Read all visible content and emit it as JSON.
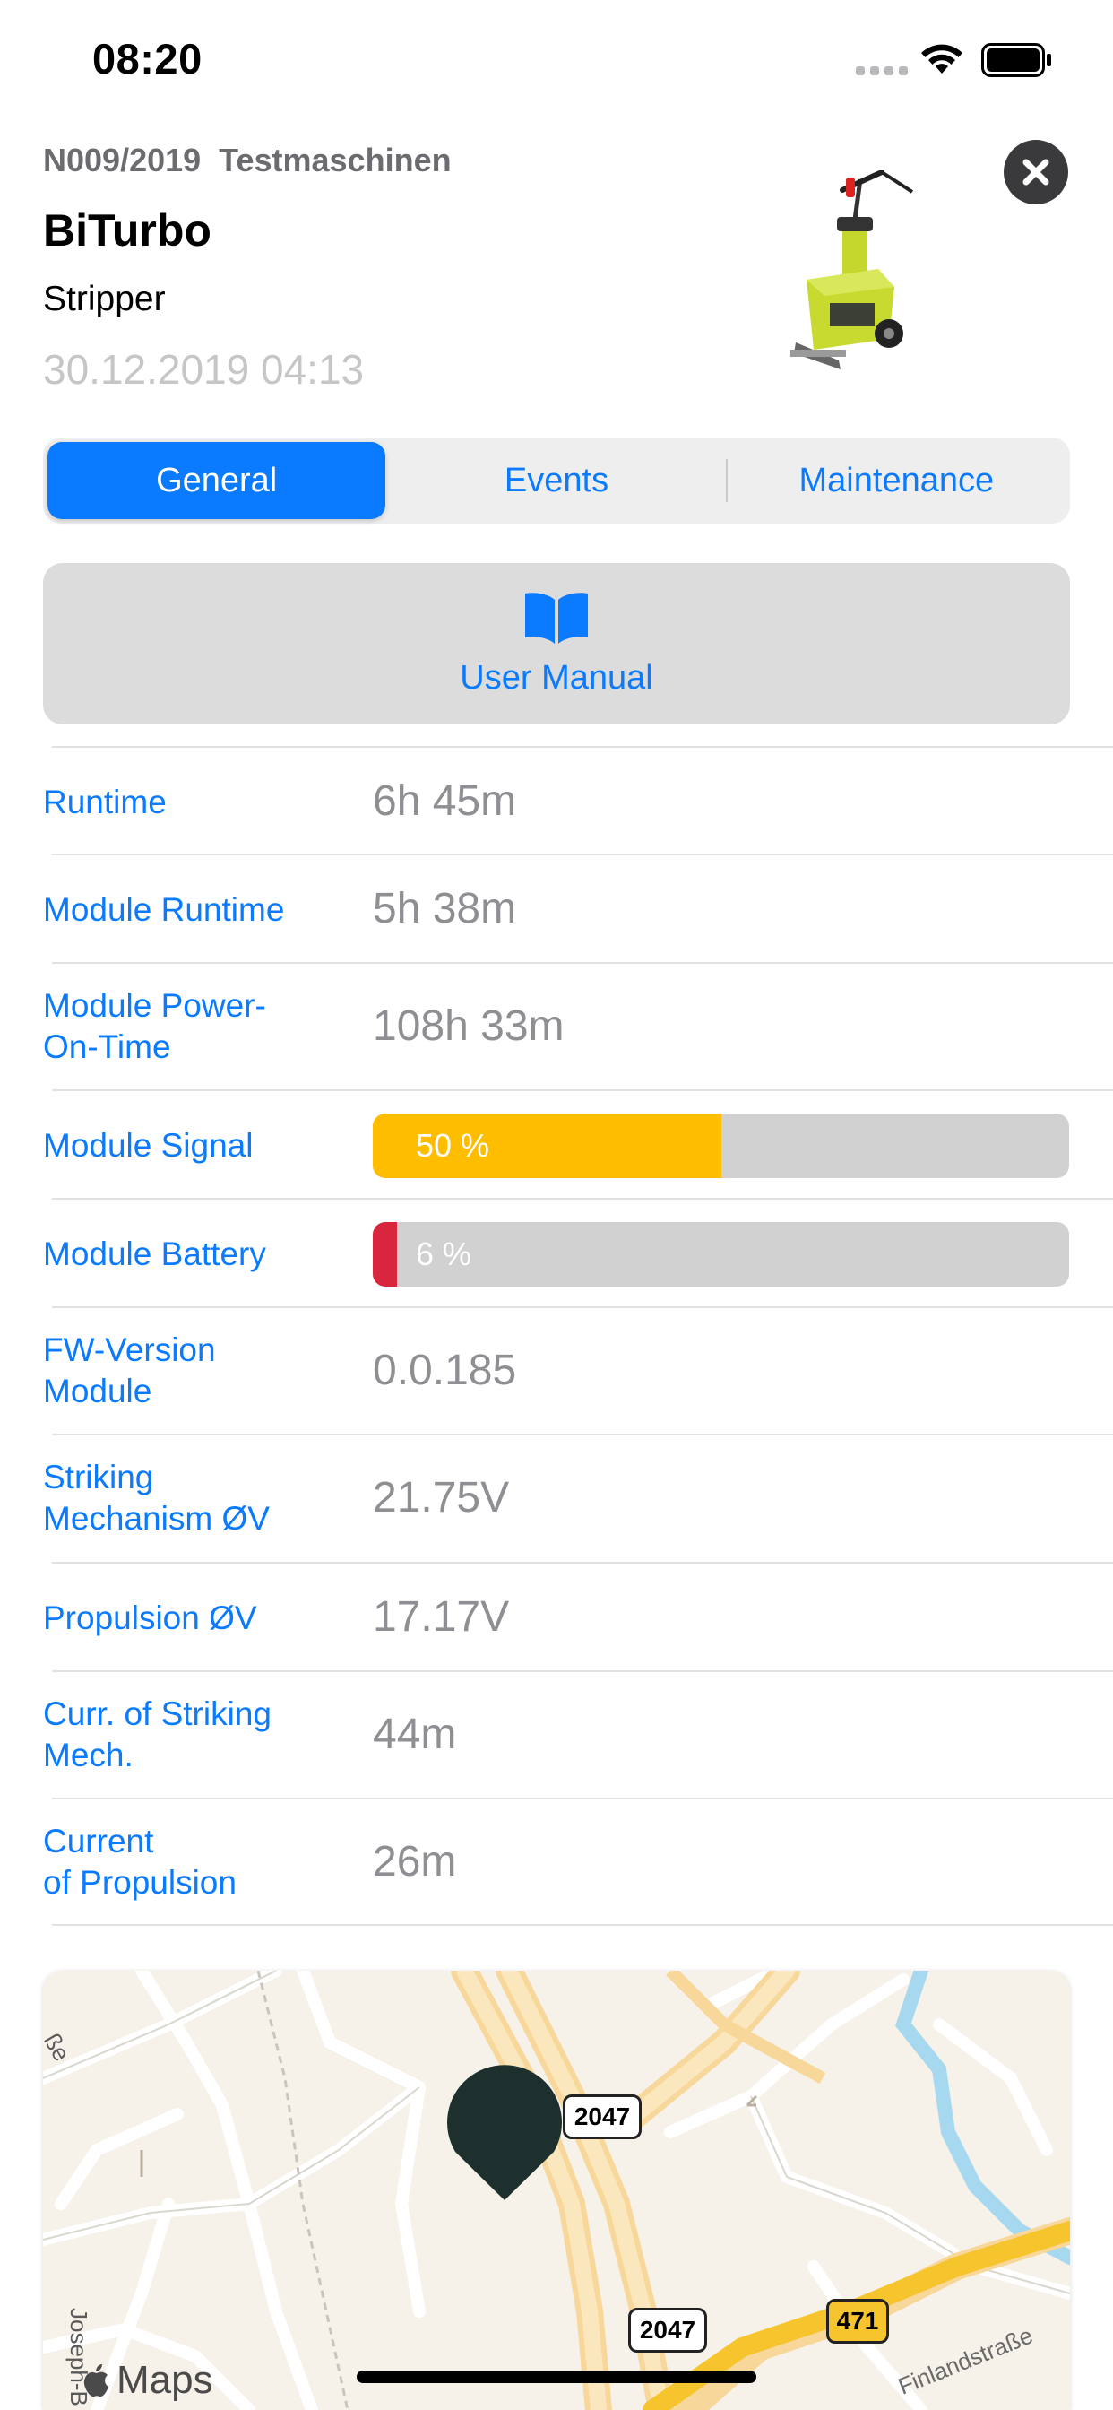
{
  "status_bar": {
    "time": "08:20"
  },
  "header": {
    "machine_id": "N009/2019",
    "group": "Testmaschinen",
    "title": "BiTurbo",
    "subtitle": "Stripper",
    "date": "30.12.2019 04:13"
  },
  "tabs": [
    {
      "label": "General",
      "active": true
    },
    {
      "label": "Events",
      "active": false
    },
    {
      "label": "Maintenance",
      "active": false
    }
  ],
  "manual": {
    "label": "User Manual",
    "icon": "book-icon"
  },
  "rows": [
    {
      "label": "Runtime",
      "value": "6h 45m"
    },
    {
      "label": "Module Runtime",
      "value": "5h 38m"
    },
    {
      "label_line1": "Module Power-",
      "label_line2": "On-Time",
      "value": "108h 33m"
    },
    {
      "label": "Module Signal",
      "bar_text": "50 %",
      "percent": 50,
      "color": "#ffbd00"
    },
    {
      "label": "Module Battery",
      "bar_text": "6 %",
      "percent": 6,
      "color": "#d8263e"
    },
    {
      "label_line1": "FW-Version",
      "label_line2": "Module",
      "value": "0.0.185"
    },
    {
      "label_line1": "Striking",
      "label_line2": "Mechanism ØV",
      "value": "21.75V"
    },
    {
      "label": "Propulsion ØV",
      "value": "17.17V"
    },
    {
      "label_line1": "Curr. of Striking",
      "label_line2": "Mech.",
      "value": "44m"
    },
    {
      "label_line1": "Current",
      "label_line2": "of Propulsion",
      "value": "26m"
    }
  ],
  "map": {
    "road_badges": [
      "2047",
      "2047",
      "471"
    ],
    "street_labels": [
      "Joseph-B",
      "Finlandstraße",
      "ße"
    ],
    "attribution": "Maps"
  },
  "colors": {
    "accent": "#0a7aff",
    "signal": "#ffbd00",
    "battery_low": "#d8263e"
  }
}
